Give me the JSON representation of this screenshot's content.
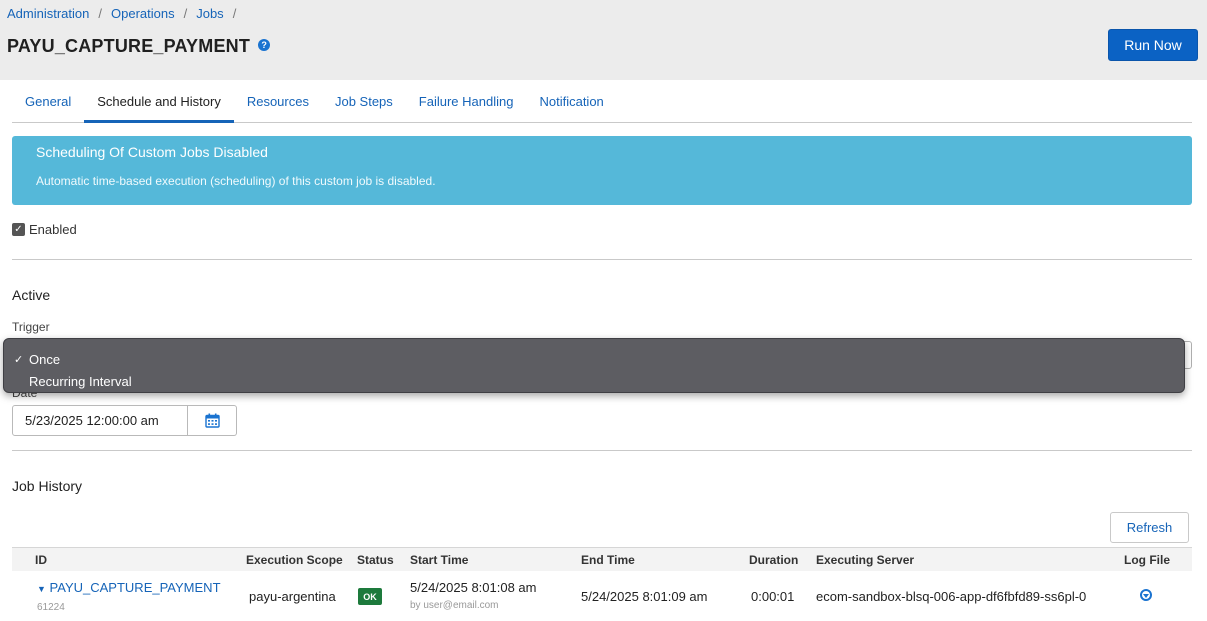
{
  "breadcrumb": {
    "items": [
      "Administration",
      "Operations",
      "Jobs"
    ],
    "separator": "/"
  },
  "page": {
    "title": "PAYU_CAPTURE_PAYMENT",
    "help_icon": "?",
    "run_now_label": "Run Now"
  },
  "tabs": [
    {
      "label": "General",
      "active": false
    },
    {
      "label": "Schedule and History",
      "active": true
    },
    {
      "label": "Resources",
      "active": false
    },
    {
      "label": "Job Steps",
      "active": false
    },
    {
      "label": "Failure Handling",
      "active": false
    },
    {
      "label": "Notification",
      "active": false
    }
  ],
  "alert": {
    "title": "Scheduling Of Custom Jobs Disabled",
    "text": "Automatic time-based execution (scheduling) of this custom job is disabled.",
    "color": "#55b8d9"
  },
  "enabled": {
    "label": "Enabled",
    "checked": true
  },
  "active_section": {
    "title": "Active",
    "trigger_label": "Trigger",
    "trigger_options": [
      {
        "label": "Once",
        "selected": true
      },
      {
        "label": "Recurring Interval",
        "selected": false
      }
    ],
    "check_mark": "✓",
    "date_label": "Date",
    "date_value": "5/23/2025 12:00:00 am",
    "calendar_icon": "calendar-icon"
  },
  "job_history": {
    "title": "Job History",
    "refresh_label": "Refresh",
    "columns": [
      "ID",
      "Execution Scope",
      "Status",
      "Start Time",
      "End Time",
      "Duration",
      "Executing Server",
      "Log File"
    ],
    "rows": [
      {
        "id": "PAYU_CAPTURE_PAYMENT",
        "id_sub": "61224",
        "scope": "payu-argentina",
        "status": "OK",
        "start_time": "5/24/2025 8:01:08 am",
        "start_by": "by user@email.com",
        "end_time": "5/24/2025 8:01:09 am",
        "duration": "0:00:01",
        "server": "ecom-sandbox-blsq-006-app-df6fbfd89-ss6pl-0",
        "log_icon": "download-circle-icon"
      }
    ]
  },
  "colors": {
    "primary": "#0b62c4",
    "link": "#1664b8",
    "status_ok": "#1d7a3c"
  }
}
